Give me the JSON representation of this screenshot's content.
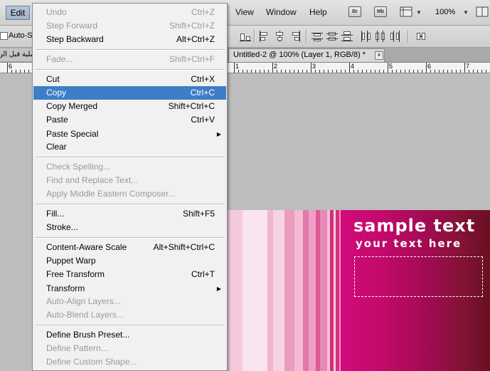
{
  "menubar": {
    "edit": "Edit",
    "items": [
      "View",
      "Window",
      "Help"
    ],
    "bridge_icon": "Br",
    "minibridge_icon": "Mb",
    "zoom": "100%"
  },
  "options": {
    "auto_select": "Auto-S"
  },
  "tabs": {
    "left_tab": "ملية قبل الن",
    "active_title": "Untitled-2 @ 100% (Layer 1, RGB/8) *",
    "close": "×"
  },
  "rulers": {
    "left": [
      "6"
    ],
    "right": [
      "1",
      "2",
      "3",
      "4",
      "5",
      "6",
      "7",
      "8"
    ]
  },
  "banner": {
    "title": "sample text",
    "subtitle": "your text here"
  },
  "edit_menu": {
    "items": [
      {
        "label": "Undo",
        "shortcut": "Ctrl+Z",
        "disabled": true
      },
      {
        "label": "Step Forward",
        "shortcut": "Shift+Ctrl+Z",
        "disabled": true
      },
      {
        "label": "Step Backward",
        "shortcut": "Alt+Ctrl+Z",
        "disabled": false
      },
      {
        "label": "Fade...",
        "shortcut": "Shift+Ctrl+F",
        "disabled": true
      },
      {
        "label": "Cut",
        "shortcut": "Ctrl+X",
        "disabled": false
      },
      {
        "label": "Copy",
        "shortcut": "Ctrl+C",
        "disabled": false,
        "highlighted": true
      },
      {
        "label": "Copy Merged",
        "shortcut": "Shift+Ctrl+C",
        "disabled": false
      },
      {
        "label": "Paste",
        "shortcut": "Ctrl+V",
        "disabled": false
      },
      {
        "label": "Paste Special",
        "shortcut": "",
        "disabled": false,
        "submenu": true
      },
      {
        "label": "Clear",
        "shortcut": "",
        "disabled": false
      },
      {
        "label": "Check Spelling...",
        "shortcut": "",
        "disabled": true
      },
      {
        "label": "Find and Replace Text...",
        "shortcut": "",
        "disabled": true
      },
      {
        "label": "Apply Middle Eastern Composer...",
        "shortcut": "",
        "disabled": true
      },
      {
        "label": "Fill...",
        "shortcut": "Shift+F5",
        "disabled": false
      },
      {
        "label": "Stroke...",
        "shortcut": "",
        "disabled": false
      },
      {
        "label": "Content-Aware Scale",
        "shortcut": "Alt+Shift+Ctrl+C",
        "disabled": false
      },
      {
        "label": "Puppet Warp",
        "shortcut": "",
        "disabled": false
      },
      {
        "label": "Free Transform",
        "shortcut": "Ctrl+T",
        "disabled": false
      },
      {
        "label": "Transform",
        "shortcut": "",
        "disabled": false,
        "submenu": true
      },
      {
        "label": "Auto-Align Layers...",
        "shortcut": "",
        "disabled": true
      },
      {
        "label": "Auto-Blend Layers...",
        "shortcut": "",
        "disabled": true
      },
      {
        "label": "Define Brush Preset...",
        "shortcut": "",
        "disabled": false
      },
      {
        "label": "Define Pattern...",
        "shortcut": "",
        "disabled": true
      },
      {
        "label": "Define Custom Shape...",
        "shortcut": "",
        "disabled": true
      }
    ]
  },
  "colors": {
    "highlight": "#3e7ec7",
    "menu_bg": "#f1f1f1",
    "banner_dark": "#6d0f1f",
    "banner_pink": "#d0197a"
  }
}
